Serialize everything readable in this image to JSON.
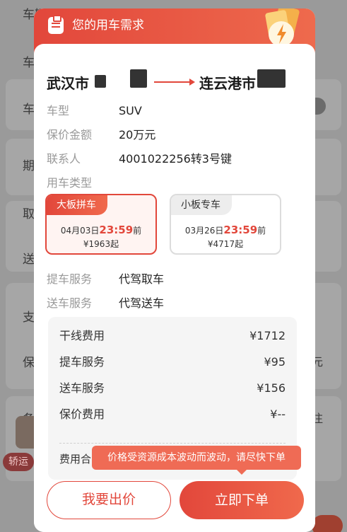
{
  "background": {
    "rows": [
      "车辆",
      "车",
      "车",
      "期",
      "取",
      "送",
      "支",
      "保",
      "备"
    ],
    "tag": "轿运",
    "right_snippets": [
      "元",
      "注"
    ]
  },
  "modal": {
    "title": "您的用车需求",
    "header_icon": "clipboard-icon",
    "route": {
      "from": "武汉市",
      "to": "连云港市"
    },
    "info": {
      "car_type_label": "车型",
      "car_type_value": "SUV",
      "insured_label": "保价金额",
      "insured_value": "20万元",
      "contact_label": "联系人",
      "contact_value": "4001022256转3号键",
      "usage_label": "用车类型"
    },
    "options": [
      {
        "tag": "大板拼车",
        "date": "04月03日",
        "time": "23:59",
        "suffix": "前",
        "price": "¥1963起",
        "selected": true
      },
      {
        "tag": "小板专车",
        "date": "03月26日",
        "time": "23:59",
        "suffix": "前",
        "price": "¥4717起",
        "selected": false
      }
    ],
    "services": {
      "pickup_label": "提车服务",
      "pickup_value": "代驾取车",
      "delivery_label": "送车服务",
      "delivery_value": "代驾送车"
    },
    "fees": [
      {
        "label": "干线费用",
        "amount": "¥1712"
      },
      {
        "label": "提车服务",
        "amount": "¥95"
      },
      {
        "label": "送车服务",
        "amount": "¥156"
      },
      {
        "label": "保价费用",
        "amount": "¥--"
      }
    ],
    "total_label": "费用合",
    "tip": "价格受资源成本波动而波动，请尽快下单",
    "bid_button": "我要出价",
    "order_button": "立即下单"
  },
  "colors": {
    "accent": "#e2473b",
    "accent_light": "#f0694c",
    "tip_bg": "#ef6b55"
  }
}
